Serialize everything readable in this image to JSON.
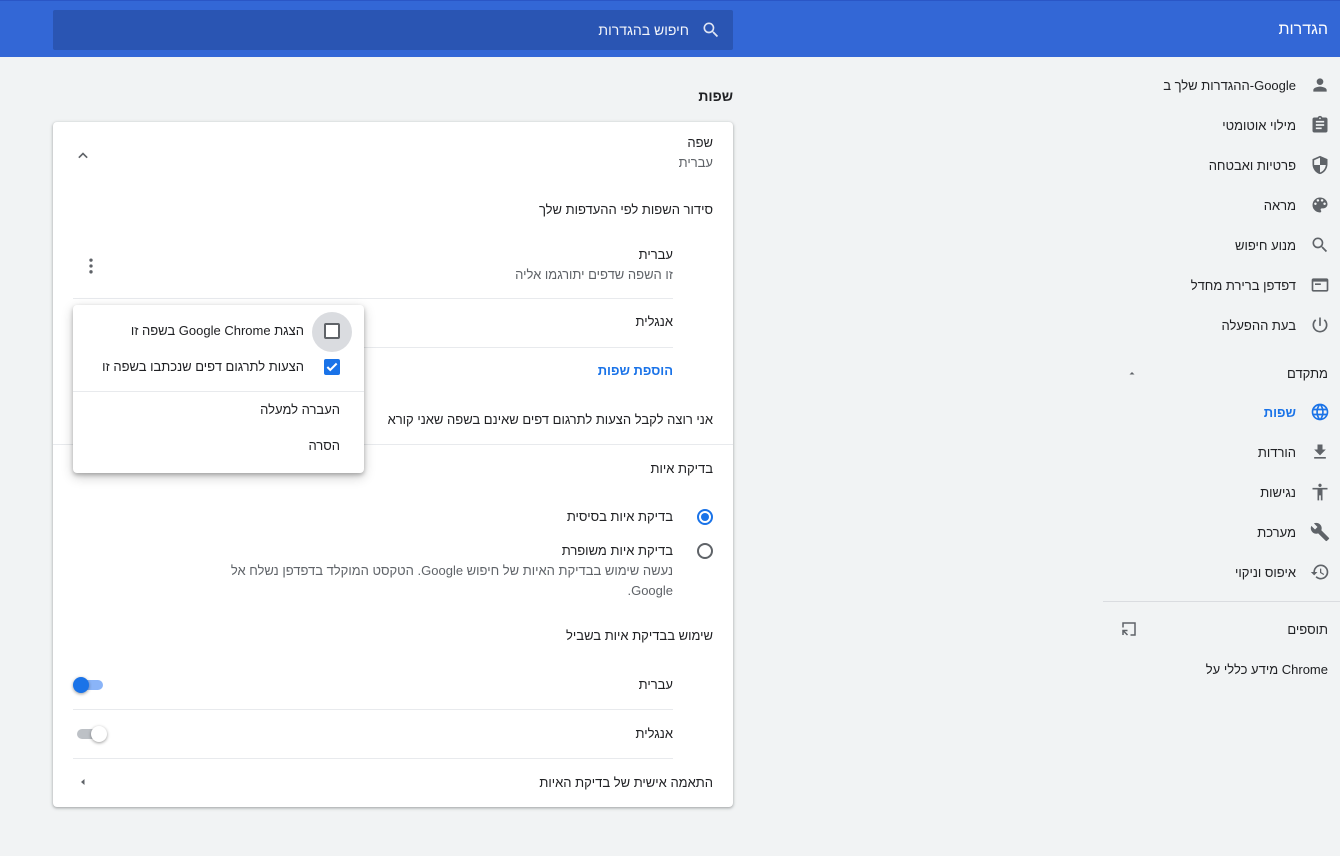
{
  "header": {
    "title": "הגדרות",
    "search_placeholder": "חיפוש בהגדרות"
  },
  "sidebar": {
    "items": [
      {
        "label": "ההגדרות שלך ב-Google",
        "icon": "person-icon"
      },
      {
        "label": "מילוי אוטומטי",
        "icon": "clipboard-icon"
      },
      {
        "label": "פרטיות ואבטחה",
        "icon": "shield-icon"
      },
      {
        "label": "מראה",
        "icon": "palette-icon"
      },
      {
        "label": "מנוע חיפוש",
        "icon": "search-icon"
      },
      {
        "label": "דפדפן ברירת מחדל",
        "icon": "browser-icon"
      },
      {
        "label": "בעת ההפעלה",
        "icon": "power-icon"
      }
    ],
    "advanced_label": "מתקדם",
    "advanced_items": [
      {
        "label": "שפות",
        "icon": "globe-icon",
        "active": true
      },
      {
        "label": "הורדות",
        "icon": "download-icon"
      },
      {
        "label": "נגישות",
        "icon": "accessibility-icon"
      },
      {
        "label": "מערכת",
        "icon": "wrench-icon"
      },
      {
        "label": "איפוס וניקוי",
        "icon": "history-icon"
      }
    ],
    "extensions_label": "תוספים",
    "about_label": "מידע כללי על Chrome"
  },
  "main": {
    "section_title": "שפות",
    "language": {
      "title": "שפה",
      "value": "עברית",
      "order_label": "סידור השפות לפי ההעדפות שלך",
      "languages": [
        {
          "name": "עברית",
          "sub": "זו השפה שדפים יתורגמו אליה"
        },
        {
          "name": "אנגלית",
          "sub": ""
        }
      ],
      "add_languages": "הוספת שפות",
      "offer_translate": "אני רוצה לקבל הצעות לתרגום דפים שאינם בשפה שאני קורא"
    },
    "spellcheck": {
      "title": "בדיקת איות",
      "basic": "בדיקת איות בסיסית",
      "enhanced": "בדיקת איות משופרת",
      "enhanced_desc_line1": "נעשה שימוש בבדיקת האיות של חיפוש Google. הטקסט המוקלד בדפדפן נשלח אל",
      "enhanced_desc_line2": "Google.",
      "use_for": "שימוש בבדיקת איות בשביל",
      "langs": [
        {
          "name": "עברית",
          "enabled": true
        },
        {
          "name": "אנגלית",
          "enabled": false
        }
      ],
      "custom": "התאמה אישית של בדיקת האיות"
    }
  },
  "popup": {
    "display_in_lang": "הצגת Google Chrome בשפה זו",
    "display_checked": false,
    "offer_translate_lang": "הצעות לתרגום דפים שנכתבו בשפה זו",
    "offer_checked": true,
    "move_up": "העברה למעלה",
    "remove": "הסרה"
  },
  "colors": {
    "header_bg": "#3367d6",
    "search_bg": "#2a55b3",
    "accent": "#1a73e8",
    "page_bg": "#f1f3f4"
  }
}
